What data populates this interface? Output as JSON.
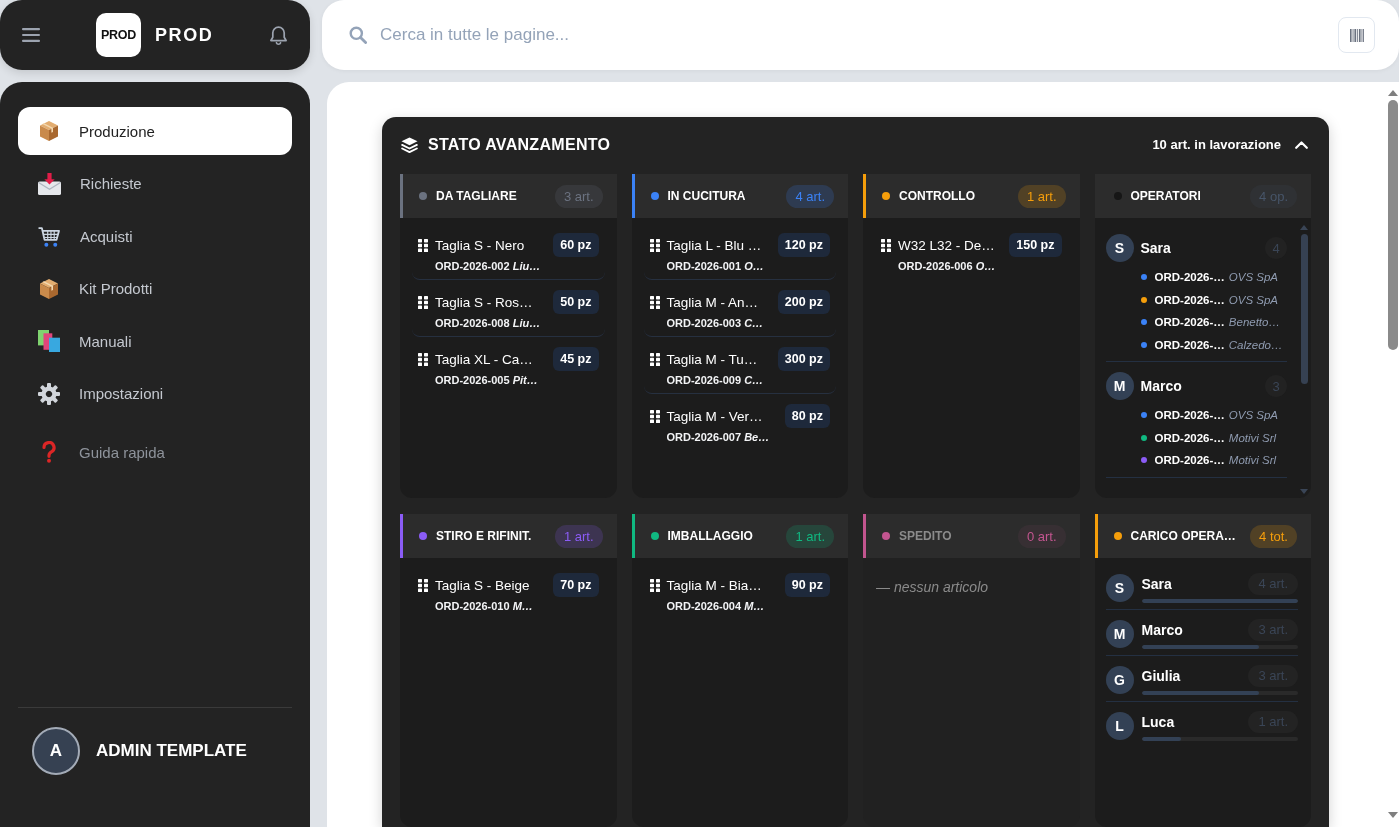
{
  "header": {
    "logo_text": "PROD",
    "brand": "PROD"
  },
  "search": {
    "placeholder": "Cerca in tutte le pagine..."
  },
  "sidebar": {
    "items": [
      {
        "label": "Produzione",
        "selected": true,
        "kind": "page"
      },
      {
        "label": "Richieste",
        "selected": false,
        "kind": "page"
      },
      {
        "label": "Acquisti",
        "selected": false,
        "kind": "page"
      },
      {
        "label": "Kit Prodotti",
        "selected": false,
        "kind": "page"
      },
      {
        "label": "Manuali",
        "selected": false,
        "kind": "page"
      },
      {
        "label": "Impostazioni",
        "selected": false,
        "kind": "page"
      },
      {
        "label": "Guida rapida",
        "selected": false,
        "kind": "help"
      }
    ],
    "user": {
      "initial": "A",
      "name": "ADMIN TEMPLATE"
    }
  },
  "board": {
    "title": "STATO AVANZAMENTO",
    "summary": "10 art. in lavorazione",
    "expanded": true,
    "columns": [
      {
        "kind": "stage",
        "title": "DA TAGLIARE",
        "color": "#6b7280",
        "count": "3 art.",
        "dimmed": false,
        "items": [
          {
            "title": "Taglia S - Nero",
            "qty": "60 pz",
            "ref": "ORD-2026-002 *Liu…*"
          },
          {
            "title": "Taglia S - Ros…",
            "qty": "50 pz",
            "ref": "ORD-2026-008 *Liu…*"
          },
          {
            "title": "Taglia XL - Ca…",
            "qty": "45 pz",
            "ref": "ORD-2026-005 *Pit…*"
          }
        ]
      },
      {
        "kind": "stage",
        "title": "IN CUCITURA",
        "color": "#3b82f6",
        "count": "4 art.",
        "dimmed": false,
        "items": [
          {
            "title": "Taglia L - Blu …",
            "qty": "120 pz",
            "ref": "ORD-2026-001 *O…*"
          },
          {
            "title": "Taglia M - An…",
            "qty": "200 pz",
            "ref": "ORD-2026-003 *C…*"
          },
          {
            "title": "Taglia M - Tu…",
            "qty": "300 pz",
            "ref": "ORD-2026-009 *C…*"
          },
          {
            "title": "Taglia M - Ver…",
            "qty": "80 pz",
            "ref": "ORD-2026-007 *Be…*"
          }
        ]
      },
      {
        "kind": "stage",
        "title": "CONTROLLO",
        "color": "#f59e0b",
        "count": "1 art.",
        "dimmed": false,
        "items": [
          {
            "title": "W32 L32 - De…",
            "qty": "150 pz",
            "ref": "ORD-2026-006 *O…*"
          }
        ]
      },
      {
        "kind": "operators",
        "title": "OPERATORI",
        "color": "#161616",
        "count": "4 op.",
        "dimmed": false,
        "operators": [
          {
            "initial": "S",
            "name": "Sara",
            "count": "4",
            "orders": [
              {
                "code": "ORD-2026-…",
                "customer": "OVS SpA",
                "color": "#3b82f6"
              },
              {
                "code": "ORD-2026-…",
                "customer": "OVS SpA",
                "color": "#f59e0b"
              },
              {
                "code": "ORD-2026-…",
                "customer": "Benetto…",
                "color": "#3b82f6"
              },
              {
                "code": "ORD-2026-…",
                "customer": "Calzedo…",
                "color": "#3b82f6"
              }
            ]
          },
          {
            "initial": "M",
            "name": "Marco",
            "count": "3",
            "orders": [
              {
                "code": "ORD-2026-…",
                "customer": "OVS SpA",
                "color": "#3b82f6"
              },
              {
                "code": "ORD-2026-…",
                "customer": "Motivi Srl",
                "color": "#10b981"
              },
              {
                "code": "ORD-2026-…",
                "customer": "Motivi Srl",
                "color": "#8b5cf6"
              }
            ]
          }
        ]
      },
      {
        "kind": "stage",
        "title": "STIRO E RIFINIT.",
        "color": "#8b5cf6",
        "count": "1 art.",
        "dimmed": false,
        "items": [
          {
            "title": "Taglia S - Beige",
            "qty": "70 pz",
            "ref": "ORD-2026-010 *M…*"
          }
        ]
      },
      {
        "kind": "stage",
        "title": "IMBALLAGGIO",
        "color": "#10b981",
        "count": "1 art.",
        "dimmed": false,
        "items": [
          {
            "title": "Taglia M - Bia…",
            "qty": "90 pz",
            "ref": "ORD-2026-004 *M…*"
          }
        ]
      },
      {
        "kind": "stage",
        "title": "SPEDITO",
        "color": "#c2558f",
        "count": "0 art.",
        "dimmed": true,
        "empty_text": "— nessun articolo"
      },
      {
        "kind": "load",
        "title": "CARICO OPERA…",
        "color": "#f59e0b",
        "count": "4 tot.",
        "dimmed": false,
        "rows": [
          {
            "initial": "S",
            "name": "Sara",
            "count": "4 art.",
            "level": 1
          },
          {
            "initial": "M",
            "name": "Marco",
            "count": "3 art.",
            "level": 0.75
          },
          {
            "initial": "G",
            "name": "Giulia",
            "count": "3 art.",
            "level": 0.75
          },
          {
            "initial": "L",
            "name": "Luca",
            "count": "1 art.",
            "level": 0.25
          }
        ]
      }
    ]
  }
}
